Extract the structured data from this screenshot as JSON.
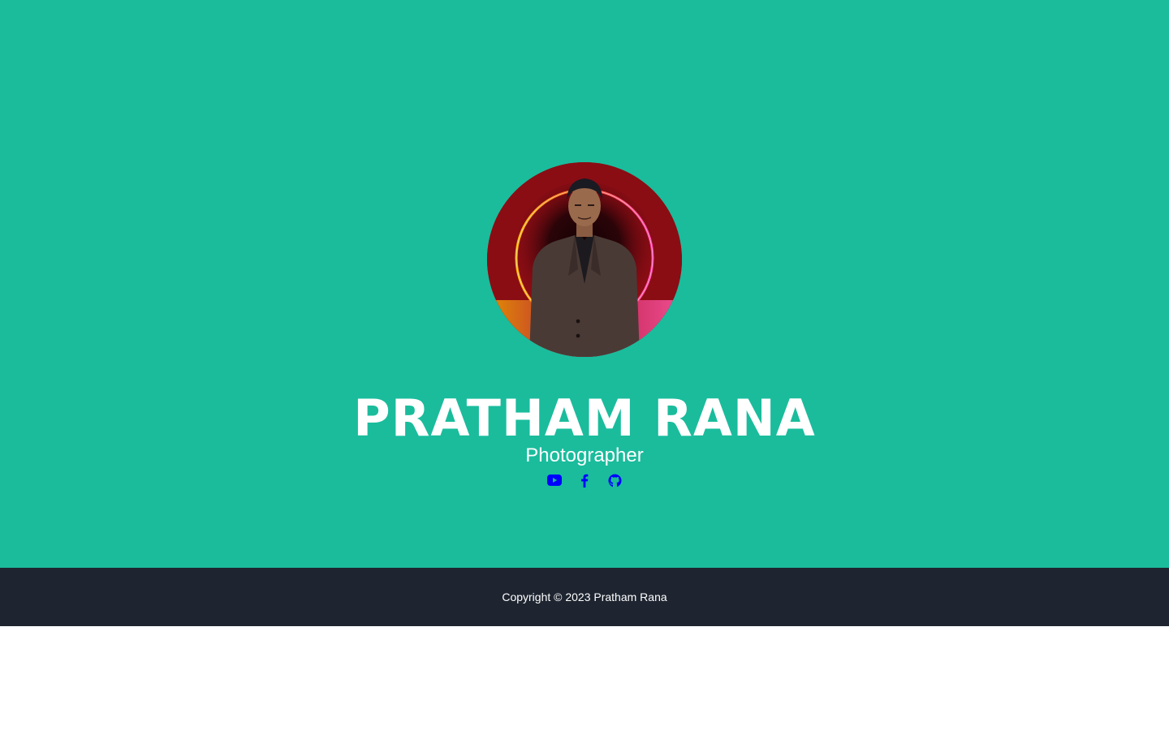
{
  "hero": {
    "name": "PRATHAM RANA",
    "subtitle": "Photographer",
    "background_color": "#1abc9c",
    "avatar": {
      "description_icon": "profile-photo"
    },
    "social_links": [
      {
        "icon": "youtube-icon",
        "color": "#0000ff"
      },
      {
        "icon": "facebook-icon",
        "color": "#0000ff"
      },
      {
        "icon": "github-icon",
        "color": "#0000ff"
      }
    ]
  },
  "footer": {
    "copyright": "Copyright © 2023 Pratham Rana",
    "background_color": "#1e2530"
  }
}
